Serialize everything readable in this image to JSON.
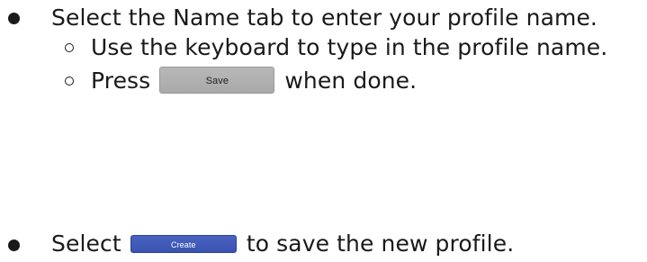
{
  "items": [
    {
      "text": "Select the Name tab to enter your profile name.",
      "subitems": [
        {
          "text": "Use the keyboard to type in the profile name."
        },
        {
          "before": "Press",
          "button": "Save",
          "after": "when done."
        }
      ]
    },
    {
      "before": "Select",
      "button": "Create",
      "after": "to save the new profile."
    }
  ],
  "colors": {
    "save_button": "#aeaeae",
    "create_button": "#3f57b8"
  }
}
